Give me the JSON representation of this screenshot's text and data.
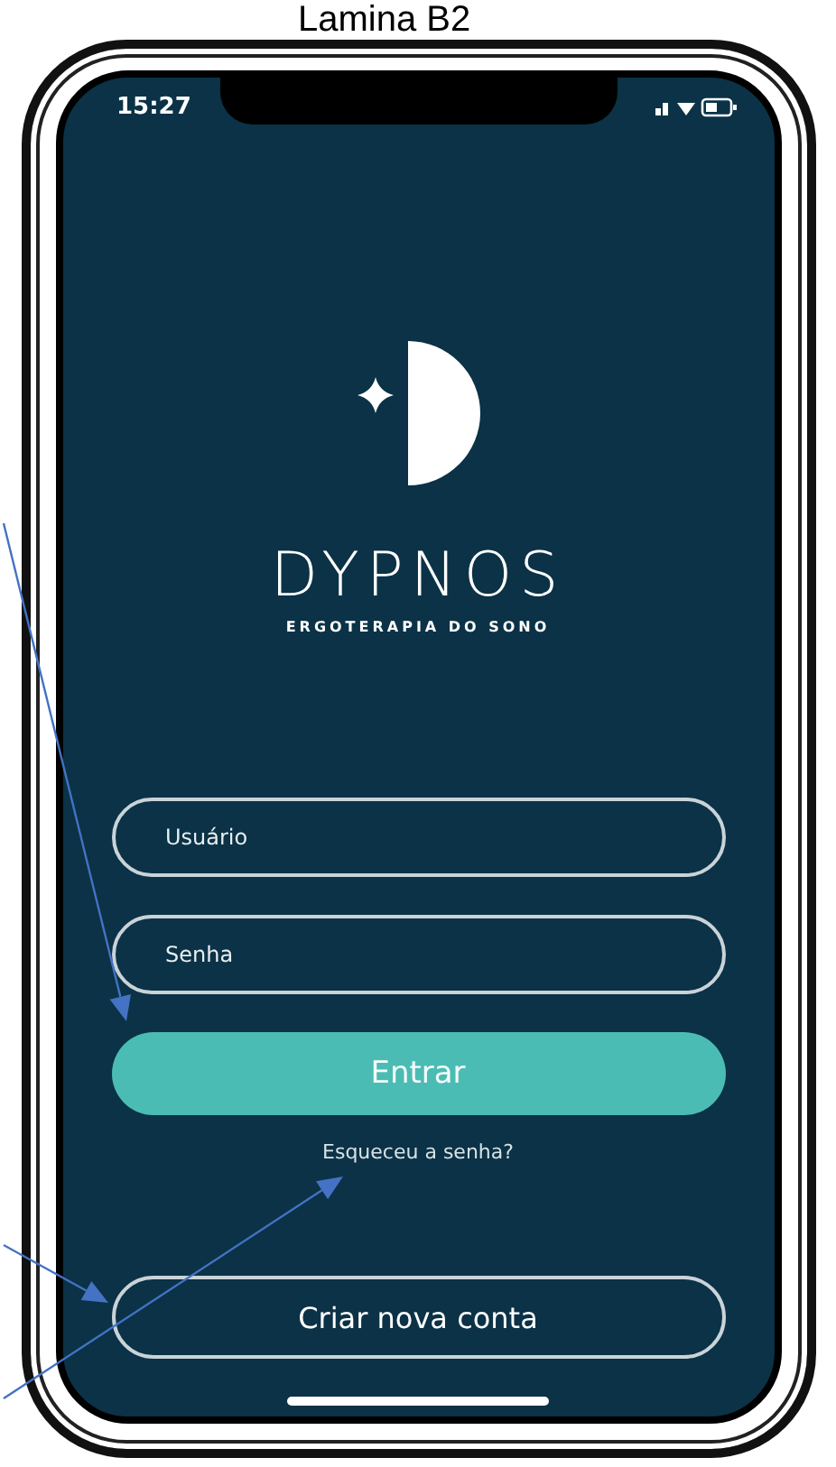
{
  "caption": "Lamina B2",
  "status_bar": {
    "time": "15:27"
  },
  "brand": {
    "name": "DYPNOS",
    "tagline": "ERGOTERAPIA DO SONO"
  },
  "fields": [
    {
      "placeholder": "Usuário"
    },
    {
      "placeholder": "Senha"
    }
  ],
  "login_button": "Entrar",
  "forgot_link": "Esqueceu a senha?",
  "signup_button": "Criar nova conta"
}
